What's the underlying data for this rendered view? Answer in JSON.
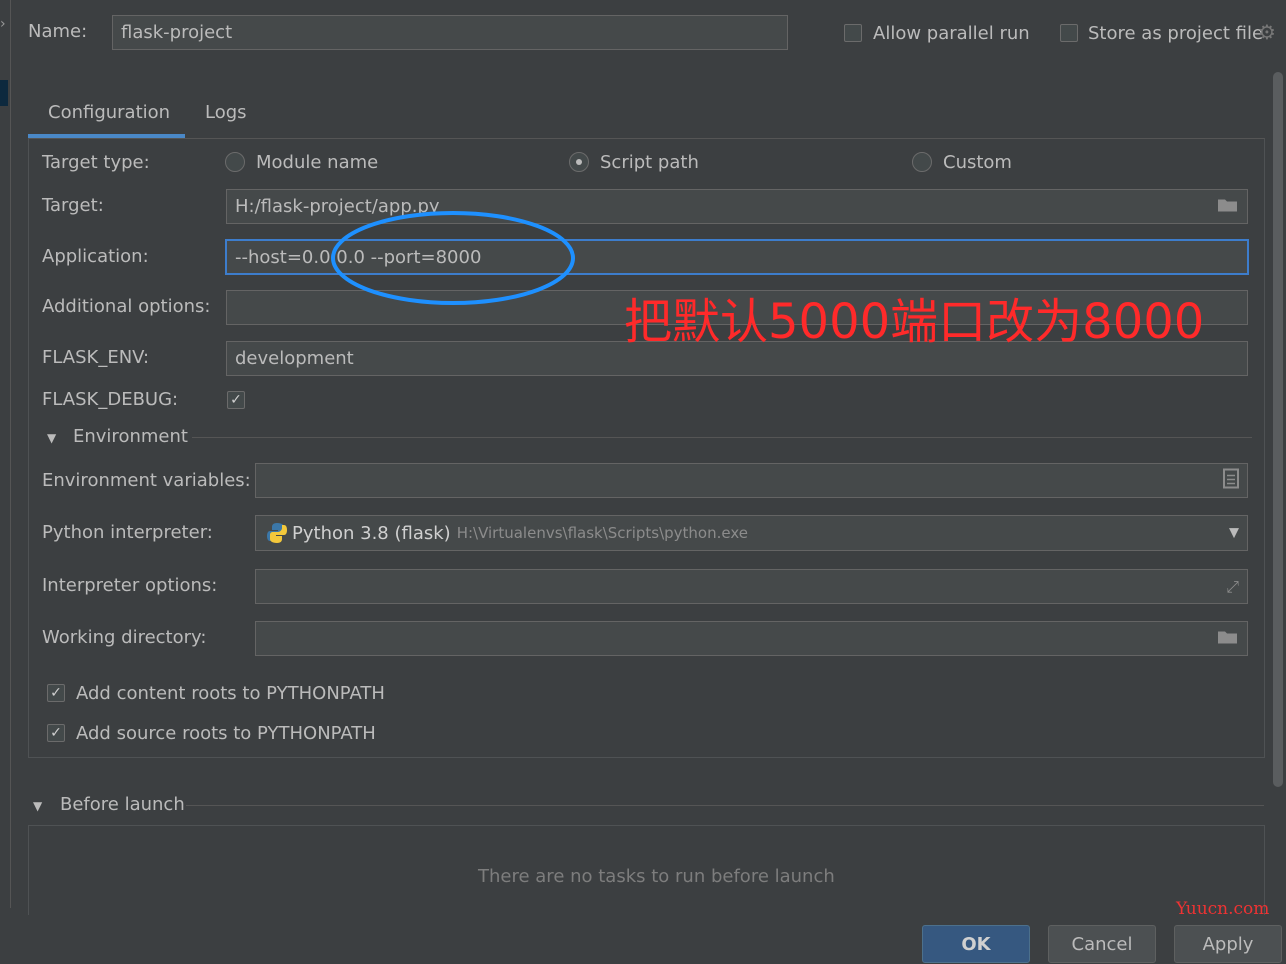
{
  "header": {
    "name_label": "Name:",
    "name_value": "flask-project",
    "allow_parallel_label": "Allow parallel run",
    "allow_parallel_checked": false,
    "store_project_label": "Store as project file",
    "store_project_checked": false
  },
  "tabs": [
    {
      "label": "Configuration",
      "active": true
    },
    {
      "label": "Logs",
      "active": false
    }
  ],
  "target_type": {
    "label": "Target type:",
    "options": [
      {
        "label": "Module name",
        "selected": false
      },
      {
        "label": "Script path",
        "selected": true
      },
      {
        "label": "Custom",
        "selected": false
      }
    ]
  },
  "fields": {
    "target": {
      "label": "Target:",
      "value": "H:/flask-project/app.py"
    },
    "application": {
      "label": "Application:",
      "value": "--host=0.0.0.0 --port=8000"
    },
    "additional_options": {
      "label": "Additional options:",
      "value": ""
    },
    "flask_env": {
      "label": "FLASK_ENV:",
      "value": "development"
    },
    "flask_debug": {
      "label": "FLASK_DEBUG:",
      "checked": true
    }
  },
  "environment": {
    "section_label": "Environment",
    "env_vars_label": "Environment variables:",
    "env_vars_value": "",
    "interpreter_label": "Python interpreter:",
    "interpreter_name": "Python 3.8 (flask)",
    "interpreter_path": "H:\\Virtualenvs\\flask\\Scripts\\python.exe",
    "interp_options_label": "Interpreter options:",
    "interp_options_value": "",
    "workdir_label": "Working directory:",
    "workdir_value": "",
    "content_roots_label": "Add content roots to PYTHONPATH",
    "content_roots_checked": true,
    "source_roots_label": "Add source roots to PYTHONPATH",
    "source_roots_checked": true
  },
  "before_launch": {
    "section_label": "Before launch",
    "empty_text": "There are no tasks to run before launch"
  },
  "annotation": {
    "text": "把默认5000端口改为8000",
    "color": "#ff2a2a",
    "ellipse_color": "#1e90ff"
  },
  "watermark": "Yuucn.com",
  "buttons": {
    "ok": "OK",
    "cancel": "Cancel",
    "apply": "Apply"
  },
  "colors": {
    "background": "#3c3f41",
    "tab_underline": "#4a88c7",
    "primary_button": "#365880"
  }
}
